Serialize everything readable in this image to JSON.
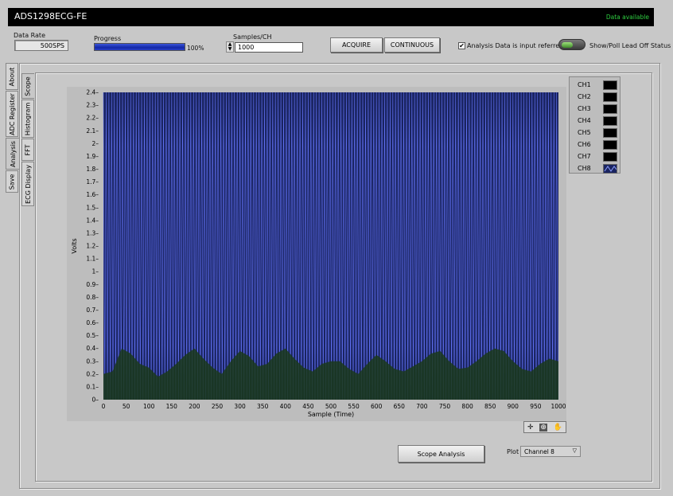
{
  "app": {
    "title": "ADS1298ECG-FE",
    "status": "Data available"
  },
  "controls": {
    "data_rate_label": "Data Rate",
    "data_rate_value": "500SPS",
    "progress_label": "Progress",
    "progress_value_text": "100%",
    "progress_fraction": 1.0,
    "samples_label": "Samples/CH",
    "samples_value": "1000",
    "acquire_label": "ACQUIRE",
    "continuous_label": "CONTINUOUS",
    "input_referred_label": "Analysis Data is input referred",
    "input_referred_checked": true,
    "lead_off_label": "Show/Poll Lead Off Status"
  },
  "outer_tabs": [
    {
      "label": "About"
    },
    {
      "label": "ADC Register"
    },
    {
      "label": "Analysis"
    },
    {
      "label": "Save"
    }
  ],
  "inner_tabs": [
    {
      "label": "Scope"
    },
    {
      "label": "Histogram"
    },
    {
      "label": "FFT"
    },
    {
      "label": "ECG Display"
    }
  ],
  "legend": [
    "CH1",
    "CH2",
    "CH3",
    "CH4",
    "CH5",
    "CH6",
    "CH7",
    "CH8"
  ],
  "scope_button_label": "Scope Analysis",
  "plot_selector": {
    "label": "Plot",
    "value": "Channel 8"
  },
  "colors": {
    "plot_bg": "#1a2460",
    "trace": "#5f6ff0",
    "envelope": "#1b3a1b",
    "status": "#2ecc40"
  },
  "chart_data": {
    "type": "line",
    "xlabel": "Sample (Time)",
    "ylabel": "Volts",
    "xlim": [
      0,
      1000
    ],
    "ylim": [
      0,
      2.4
    ],
    "x_ticks": [
      0,
      50,
      100,
      150,
      200,
      250,
      300,
      350,
      400,
      450,
      500,
      550,
      600,
      650,
      700,
      750,
      800,
      850,
      900,
      950,
      1000
    ],
    "y_ticks": [
      0,
      0.1,
      0.2,
      0.3,
      0.4,
      0.5,
      0.6,
      0.7,
      0.8,
      0.9,
      1,
      1.1,
      1.2,
      1.3,
      1.4,
      1.5,
      1.6,
      1.7,
      1.8,
      1.9,
      2,
      2.1,
      2.2,
      2.3,
      2.4
    ],
    "series": [
      {
        "name": "CH8",
        "description_values": "dense oscillation spanning 0 to 2.4 V with period of about 6 samples",
        "envelope_x": [
          0,
          20,
          40,
          60,
          80,
          100,
          120,
          140,
          160,
          180,
          200,
          220,
          240,
          260,
          280,
          300,
          320,
          340,
          360,
          380,
          400,
          420,
          440,
          460,
          480,
          500,
          520,
          540,
          560,
          580,
          600,
          620,
          640,
          660,
          680,
          700,
          720,
          740,
          760,
          780,
          800,
          820,
          840,
          860,
          880,
          900,
          920,
          940,
          960,
          980,
          1000
        ],
        "envelope_y": [
          0.2,
          0.22,
          0.4,
          0.36,
          0.28,
          0.25,
          0.18,
          0.22,
          0.28,
          0.35,
          0.4,
          0.32,
          0.25,
          0.2,
          0.3,
          0.38,
          0.34,
          0.26,
          0.28,
          0.36,
          0.4,
          0.32,
          0.25,
          0.22,
          0.28,
          0.3,
          0.3,
          0.24,
          0.2,
          0.28,
          0.35,
          0.3,
          0.24,
          0.22,
          0.26,
          0.3,
          0.36,
          0.38,
          0.3,
          0.24,
          0.25,
          0.3,
          0.36,
          0.4,
          0.38,
          0.3,
          0.24,
          0.22,
          0.28,
          0.32,
          0.3
        ]
      }
    ]
  }
}
